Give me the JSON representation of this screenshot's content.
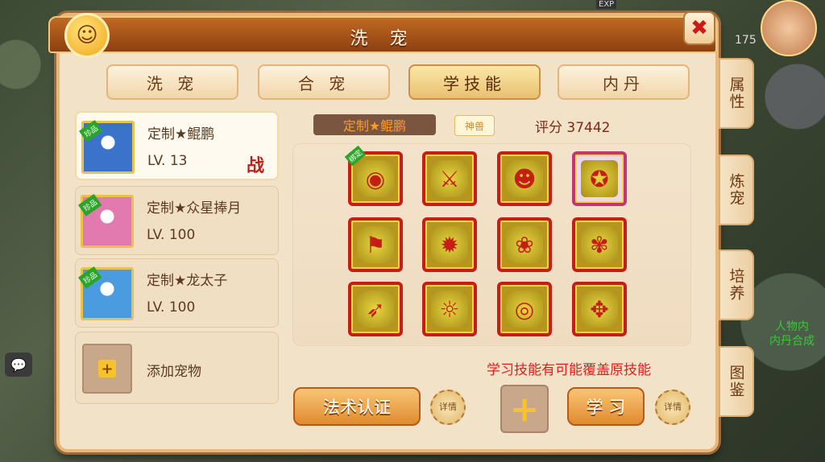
{
  "window": {
    "title": "洗 宠",
    "close_icon": "✖"
  },
  "tabs": [
    "洗 宠",
    "合 宠",
    "学技能",
    "内丹"
  ],
  "active_tab": 2,
  "pets": [
    {
      "name": "定制★鲲鹏",
      "level": "LV. 13",
      "status": "战",
      "badge": "珍品",
      "color": "#3a73c9"
    },
    {
      "name": "定制★众星捧月",
      "level": "LV. 100",
      "badge": "珍品",
      "color": "#e27ab0"
    },
    {
      "name": "定制★龙太子",
      "level": "LV. 100",
      "badge": "珍品",
      "color": "#4a9be0"
    }
  ],
  "add_pet_label": "添加宠物",
  "selected_pet_tag": "定制★鲲鹏",
  "shenshou_label": "神兽",
  "score": "评分 37442",
  "skills": [
    {
      "icon": "shield-icon",
      "glyph": "◉",
      "bound": "绑定"
    },
    {
      "icon": "weapon-icon",
      "glyph": "⚔"
    },
    {
      "icon": "bear-face-icon",
      "glyph": "☻"
    },
    {
      "icon": "monkey-icon",
      "glyph": "✪",
      "special": true
    },
    {
      "icon": "flag-icon",
      "glyph": "⚑"
    },
    {
      "icon": "demon-icon",
      "glyph": "✹"
    },
    {
      "icon": "peach-icon",
      "glyph": "❀"
    },
    {
      "icon": "runner-icon",
      "glyph": "✾"
    },
    {
      "icon": "blade-icon",
      "glyph": "➶"
    },
    {
      "icon": "lion-icon",
      "glyph": "☼"
    },
    {
      "icon": "owl-icon",
      "glyph": "◎"
    },
    {
      "icon": "bear-icon",
      "glyph": "✥"
    }
  ],
  "warning": "学习技能有可能覆盖原技能",
  "buttons": {
    "magic": "法术认证",
    "learn": "学 习",
    "detail": "详情"
  },
  "side_tabs": [
    "属性",
    "炼宠",
    "培养",
    "图鉴"
  ],
  "external": {
    "exp": "EXP",
    "level_num": "175",
    "bottom_right": "内丹合成",
    "bottom_right2": "人物内"
  }
}
